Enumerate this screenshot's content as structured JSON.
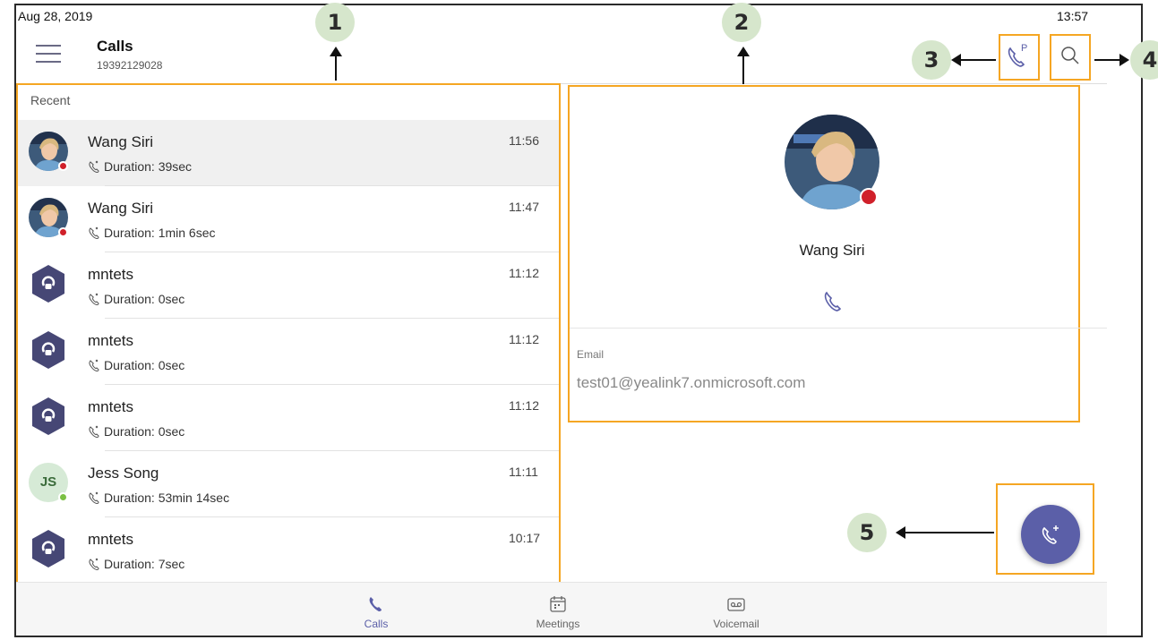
{
  "status": {
    "date": "Aug 28, 2019",
    "time": "13:57"
  },
  "header": {
    "title": "Calls",
    "phone_number": "19392129028"
  },
  "recent_label": "Recent",
  "calls": [
    {
      "name": "Wang Siri",
      "duration": "Duration: 39sec",
      "time": "11:56",
      "avatar": "photo",
      "presence": "#d0202a"
    },
    {
      "name": "Wang Siri",
      "duration": "Duration: 1min 6sec",
      "time": "11:47",
      "avatar": "photo",
      "presence": "#d0202a"
    },
    {
      "name": "mntets",
      "duration": "Duration: 0sec",
      "time": "11:12",
      "avatar": "bot"
    },
    {
      "name": "mntets",
      "duration": "Duration: 0sec",
      "time": "11:12",
      "avatar": "bot"
    },
    {
      "name": "mntets",
      "duration": "Duration: 0sec",
      "time": "11:12",
      "avatar": "bot"
    },
    {
      "name": "Jess Song",
      "duration": "Duration: 53min 14sec",
      "time": "11:11",
      "avatar": "initials",
      "initials": "JS",
      "presence": "#7bc043"
    },
    {
      "name": "mntets",
      "duration": "Duration: 7sec",
      "time": "10:17",
      "avatar": "bot"
    }
  ],
  "detail": {
    "name": "Wang Siri",
    "email_label": "Email",
    "email": "test01@yealink7.onmicrosoft.com"
  },
  "nav": [
    {
      "label": "Calls",
      "icon": "phone-icon",
      "active": true
    },
    {
      "label": "Meetings",
      "icon": "calendar-icon",
      "active": false
    },
    {
      "label": "Voicemail",
      "icon": "voicemail-icon",
      "active": false
    }
  ],
  "callouts": [
    "1",
    "2",
    "3",
    "4",
    "5"
  ],
  "colors": {
    "accent": "#5b5fa8",
    "highlight": "#f5a623",
    "callout_badge": "#d6e6cc",
    "busy": "#d0202a",
    "available": "#7bc043"
  }
}
